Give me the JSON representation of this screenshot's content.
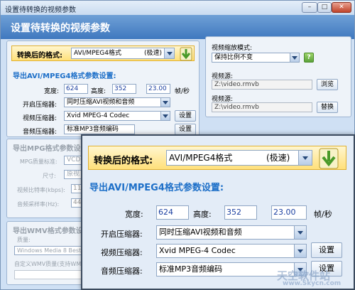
{
  "window": {
    "title": "设置待转换的视频参数",
    "header": "设置待转换的视频参数",
    "min": "–",
    "max": "□",
    "close": "✕"
  },
  "format": {
    "label": "转换后的格式:",
    "value": "AVI/MPEG4格式",
    "speed": "(极速)"
  },
  "avi_section": {
    "title": "导出AVI/MPEG4格式参数设置:",
    "width_label": "宽度:",
    "width": "624",
    "height_label": "高度:",
    "height": "352",
    "fps": "23.00",
    "fps_unit": "帧/秒",
    "enable_label": "开启压缩器:",
    "enable_value": "同时压缩AVI视频和音频",
    "video_label": "视频压缩器:",
    "video_value": "Xvid MPEG-4 Codec",
    "video_btn": "设置",
    "audio_label": "音频压缩器:",
    "audio_value": "标准MP3音频编码",
    "audio_btn": "设置"
  },
  "right": {
    "scale_label": "视频缩放模式:",
    "scale_value": "保持比例不变",
    "help": "?",
    "src_label": "视频源:",
    "src_value": "Z:\\video.rmvb",
    "browse": "浏览",
    "dst_label": "视频源:",
    "dst_value": "Z:\\video.rmvb",
    "replace": "替换"
  },
  "mpg_section": {
    "title": "导出MPG格式参数设",
    "quality_label": "MPG质量标准:",
    "quality_value": "VCD",
    "size_label": "尺寸:",
    "size_value": "原视",
    "bitrate_label": "视频比特率(kbps):",
    "bitrate_value": "11",
    "samplerate_label": "音频采样率(Hz):",
    "samplerate_value": "44"
  },
  "wmv_section": {
    "title": "导出WMV格式参数设",
    "quality_label": "质量:",
    "quality_value": "Windows Media 8 Best",
    "custom_label": "自定义WMV质量(支持WMV"
  },
  "popup": {
    "format_label": "转换后的格式:",
    "format_value": "AVI/MPEG4格式",
    "speed": "(极速)",
    "title": "导出AVI/MPEG4格式参数设置:",
    "width_label": "宽度:",
    "width": "624",
    "height_label": "高度:",
    "height": "352",
    "fps": "23.00",
    "fps_unit": "帧/秒",
    "enable_label": "开启压缩器:",
    "enable_value": "同时压缩AVI视频和音频",
    "video_label": "视频压缩器:",
    "video_value": "Xvid MPEG-4 Codec",
    "video_btn": "设置",
    "audio_label": "音频压缩器:",
    "audio_value": "标准MP3音频编码",
    "audio_btn": "设置"
  },
  "watermark": {
    "line1": "天空软件站",
    "line2": "www.Skycn.com"
  }
}
